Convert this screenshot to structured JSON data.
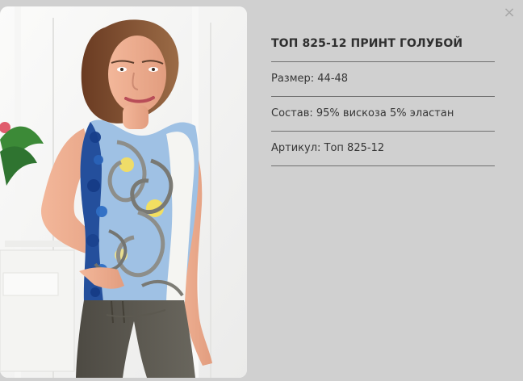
{
  "product": {
    "title": "ТОП 825-12 ПРИНТ ГОЛУБОЙ",
    "size": "Размер: 44-48",
    "composition": "Состав: 95% вискоза 5% эластан",
    "article": "Артикул: Топ 825-12"
  },
  "controls": {
    "close_label": "×"
  },
  "icons": {
    "close": "close-icon"
  },
  "colors": {
    "background": "#d0d0d0",
    "text": "#2f2f2f",
    "divider": "#6f6f6f",
    "close": "#a7a7a7"
  }
}
